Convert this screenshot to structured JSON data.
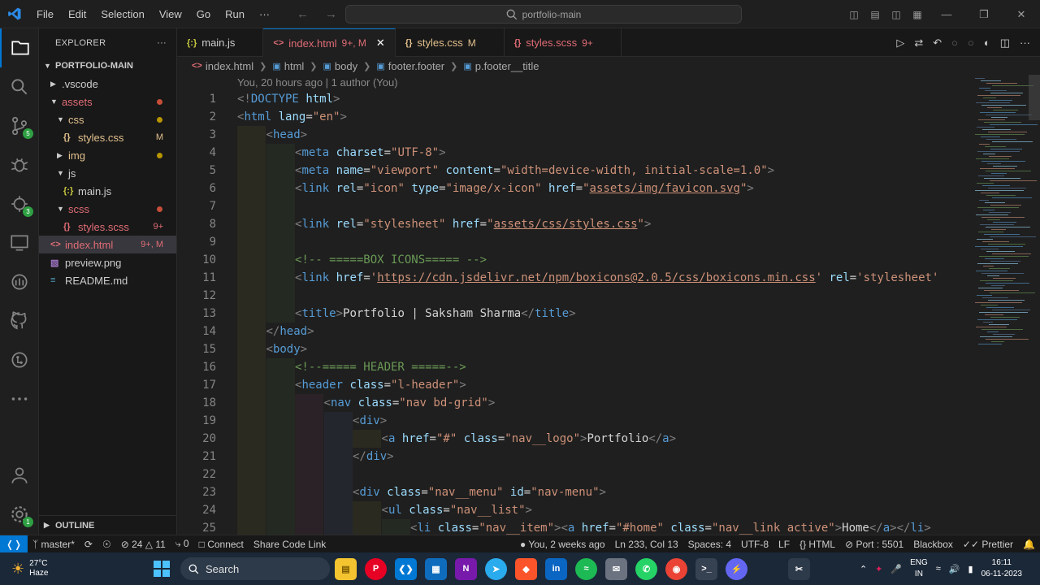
{
  "titlebar": {
    "menu": [
      "File",
      "Edit",
      "Selection",
      "View",
      "Go",
      "Run",
      "···"
    ],
    "search_text": "portfolio-main"
  },
  "explorer": {
    "title": "EXPLORER",
    "root": "PORTFOLIO-MAIN",
    "items": [
      {
        "label": ".vscode",
        "level": 1,
        "type": "folder",
        "open": false,
        "color": "#cccccc"
      },
      {
        "label": "assets",
        "level": 1,
        "type": "folder",
        "open": true,
        "color": "#e06c75",
        "dot": "#c74e39"
      },
      {
        "label": "css",
        "level": 2,
        "type": "folder",
        "open": true,
        "color": "#e2c08d",
        "dot": "#b89500"
      },
      {
        "label": "styles.css",
        "level": 3,
        "type": "css",
        "color": "#e2c08d",
        "status": "M"
      },
      {
        "label": "img",
        "level": 2,
        "type": "folder",
        "open": false,
        "color": "#e2c08d",
        "dot": "#b89500"
      },
      {
        "label": "js",
        "level": 2,
        "type": "folder",
        "open": true,
        "color": "#cccccc"
      },
      {
        "label": "main.js",
        "level": 3,
        "type": "js",
        "color": "#cccccc"
      },
      {
        "label": "scss",
        "level": 2,
        "type": "folder",
        "open": true,
        "color": "#e06c75",
        "dot": "#c74e39"
      },
      {
        "label": "styles.scss",
        "level": 3,
        "type": "scss",
        "color": "#e06c75",
        "status": "9+"
      },
      {
        "label": "index.html",
        "level": 1,
        "type": "html",
        "color": "#e06c75",
        "status": "9+, M",
        "selected": true
      },
      {
        "label": "preview.png",
        "level": 1,
        "type": "png",
        "color": "#cccccc"
      },
      {
        "label": "README.md",
        "level": 1,
        "type": "md",
        "color": "#cccccc"
      }
    ],
    "outline": "OUTLINE"
  },
  "tabs": [
    {
      "label": "main.js",
      "icon": "{:}",
      "color": "#cccccc",
      "status": "",
      "active": false
    },
    {
      "label": "index.html",
      "icon": "<>",
      "color": "#e06c75",
      "status": "9+, M",
      "active": true
    },
    {
      "label": "styles.css",
      "icon": "{}",
      "color": "#e2c08d",
      "status": "M",
      "active": false
    },
    {
      "label": "styles.scss",
      "icon": "{}",
      "color": "#e06c75",
      "status": "9+",
      "active": false
    }
  ],
  "breadcrumb": [
    "index.html",
    "html",
    "body",
    "footer.footer",
    "p.footer__title"
  ],
  "blame": "You, 20 hours ago | 1 author (You)",
  "code_lines": [
    {
      "n": "1",
      "indent": 0,
      "h": "<span class='br'>&lt;!</span><span class='tag'>DOCTYPE</span> <span class='attr'>html</span><span class='br'>&gt;</span>"
    },
    {
      "n": "2",
      "indent": 0,
      "h": "<span class='br'>&lt;</span><span class='tag'>html</span> <span class='attr'>lang</span>=<span class='str'>\"en\"</span><span class='br'>&gt;</span>"
    },
    {
      "n": "3",
      "indent": 1,
      "h": "<span class='br'>&lt;</span><span class='tag'>head</span><span class='br'>&gt;</span>"
    },
    {
      "n": "4",
      "indent": 2,
      "h": "<span class='br'>&lt;</span><span class='tag'>meta</span> <span class='attr'>charset</span>=<span class='str'>\"UTF-8\"</span><span class='br'>&gt;</span>"
    },
    {
      "n": "5",
      "indent": 2,
      "h": "<span class='br'>&lt;</span><span class='tag'>meta</span> <span class='attr'>name</span>=<span class='str'>\"viewport\"</span> <span class='attr'>content</span>=<span class='str'>\"width=device-width, initial-scale=1.0\"</span><span class='br'>&gt;</span>"
    },
    {
      "n": "6",
      "indent": 2,
      "h": "<span class='br'>&lt;</span><span class='tag'>link</span> <span class='attr'>rel</span>=<span class='str'>\"icon\"</span> <span class='attr'>type</span>=<span class='str'>\"image/x-icon\"</span> <span class='attr'>href</span>=<span class='str'>\"<span class='link'>assets/img/favicon.svg</span>\"</span><span class='br'>&gt;</span>"
    },
    {
      "n": "7",
      "indent": 2,
      "h": ""
    },
    {
      "n": "8",
      "indent": 2,
      "h": "<span class='br'>&lt;</span><span class='tag'>link</span> <span class='attr'>rel</span>=<span class='str'>\"stylesheet\"</span> <span class='attr'>href</span>=<span class='str'>\"<span class='link'>assets/css/styles.css</span>\"</span><span class='br'>&gt;</span>"
    },
    {
      "n": "9",
      "indent": 2,
      "h": ""
    },
    {
      "n": "10",
      "indent": 2,
      "h": "<span class='com'>&lt;!-- =====BOX ICONS===== --&gt;</span>"
    },
    {
      "n": "11",
      "indent": 2,
      "h": "<span class='br'>&lt;</span><span class='tag'>link</span> <span class='attr'>href</span>=<span class='str'>'<span class='link'>https://cdn.jsdelivr.net/npm/boxicons@2.0.5/css/boxicons.min.css</span>'</span> <span class='attr'>rel</span>=<span class='str'>'stylesheet'</span>"
    },
    {
      "n": "12",
      "indent": 2,
      "h": ""
    },
    {
      "n": "13",
      "indent": 2,
      "h": "<span class='br'>&lt;</span><span class='tag'>title</span><span class='br'>&gt;</span><span class='txt'>Portfolio | Saksham Sharma</span><span class='br'>&lt;/</span><span class='tag'>title</span><span class='br'>&gt;</span>"
    },
    {
      "n": "14",
      "indent": 1,
      "h": "<span class='br'>&lt;/</span><span class='tag'>head</span><span class='br'>&gt;</span>"
    },
    {
      "n": "15",
      "indent": 1,
      "h": "<span class='br'>&lt;</span><span class='tag'>body</span><span class='br'>&gt;</span>"
    },
    {
      "n": "16",
      "indent": 2,
      "h": "<span class='com'>&lt;!--===== HEADER =====--&gt;</span>"
    },
    {
      "n": "17",
      "indent": 2,
      "h": "<span class='br'>&lt;</span><span class='tag'>header</span> <span class='attr'>class</span>=<span class='str'>\"l-header\"</span><span class='br'>&gt;</span>"
    },
    {
      "n": "18",
      "indent": 3,
      "h": "<span class='br'>&lt;</span><span class='tag'>nav</span> <span class='attr'>class</span>=<span class='str'>\"nav bd-grid\"</span><span class='br'>&gt;</span>"
    },
    {
      "n": "19",
      "indent": 4,
      "h": "<span class='br'>&lt;</span><span class='tag'>div</span><span class='br'>&gt;</span>"
    },
    {
      "n": "20",
      "indent": 5,
      "h": "<span class='br'>&lt;</span><span class='tag'>a</span> <span class='attr'>href</span>=<span class='str'>\"#\"</span> <span class='attr'>class</span>=<span class='str'>\"nav__logo\"</span><span class='br'>&gt;</span><span class='txt'>Portfolio</span><span class='br'>&lt;/</span><span class='tag'>a</span><span class='br'>&gt;</span>"
    },
    {
      "n": "21",
      "indent": 4,
      "h": "<span class='br'>&lt;/</span><span class='tag'>div</span><span class='br'>&gt;</span>"
    },
    {
      "n": "22",
      "indent": 4,
      "h": ""
    },
    {
      "n": "23",
      "indent": 4,
      "h": "<span class='br'>&lt;</span><span class='tag'>div</span> <span class='attr'>class</span>=<span class='str'>\"nav__menu\"</span> <span class='attr'>id</span>=<span class='str'>\"nav-menu\"</span><span class='br'>&gt;</span>"
    },
    {
      "n": "24",
      "indent": 5,
      "h": "<span class='br'>&lt;</span><span class='tag'>ul</span> <span class='attr'>class</span>=<span class='str'>\"nav__list\"</span><span class='br'>&gt;</span>"
    },
    {
      "n": "25",
      "indent": 6,
      "h": "<span class='br'>&lt;</span><span class='tag'>li</span> <span class='attr'>class</span>=<span class='str'>\"nav__item\"</span><span class='br'>&gt;&lt;</span><span class='tag'>a</span> <span class='attr'>href</span>=<span class='str'>\"#home\"</span> <span class='attr'>class</span>=<span class='str'>\"nav__link active\"</span><span class='br'>&gt;</span><span class='txt'>Home</span><span class='br'>&lt;/</span><span class='tag'>a</span><span class='br'>&gt;&lt;/</span><span class='tag'>li</span><span class='br'>&gt;</span>"
    }
  ],
  "statusbar": {
    "branch": "master*",
    "errors": "24",
    "warnings": "11",
    "ports": "0",
    "connect": "Connect",
    "share": "Share Code Link",
    "blame": "You, 2 weeks ago",
    "position": "Ln 233, Col 13",
    "spaces": "Spaces: 4",
    "encoding": "UTF-8",
    "eol": "LF",
    "language": "HTML",
    "port": "Port : 5501",
    "blackbox": "Blackbox",
    "prettier": "Prettier"
  },
  "taskbar": {
    "temp": "27°C",
    "weather": "Haze",
    "search": "Search",
    "lang1": "ENG",
    "lang2": "IN",
    "time": "16:11",
    "date": "06-11-2023"
  },
  "colors": {
    "accent": "#0078d4",
    "badge": "#2ea043",
    "modified": "#e2c08d",
    "error": "#e06c75"
  }
}
